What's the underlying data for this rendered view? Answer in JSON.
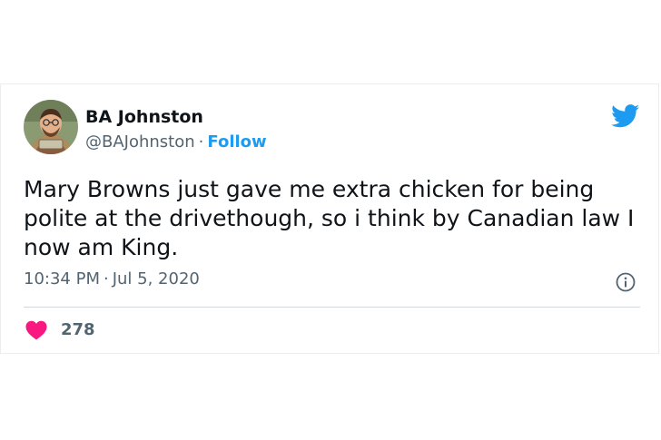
{
  "tweet": {
    "author_name": "BA Johnston",
    "handle": "@BAJohnston",
    "separator": "·",
    "follow_label": "Follow",
    "text": "Mary Browns just gave me extra chicken for being polite at the drivethough, so i think by Canadian law I now am King.",
    "time": "10:34 PM",
    "date": "Jul 5, 2020",
    "like_count": "278"
  },
  "colors": {
    "accent": "#1d9bf0",
    "heart": "#f91880",
    "text_primary": "#0f1419",
    "text_secondary": "#536471"
  },
  "icons": {
    "brand": "twitter-bird-icon",
    "info": "info-icon",
    "like": "heart-icon"
  }
}
